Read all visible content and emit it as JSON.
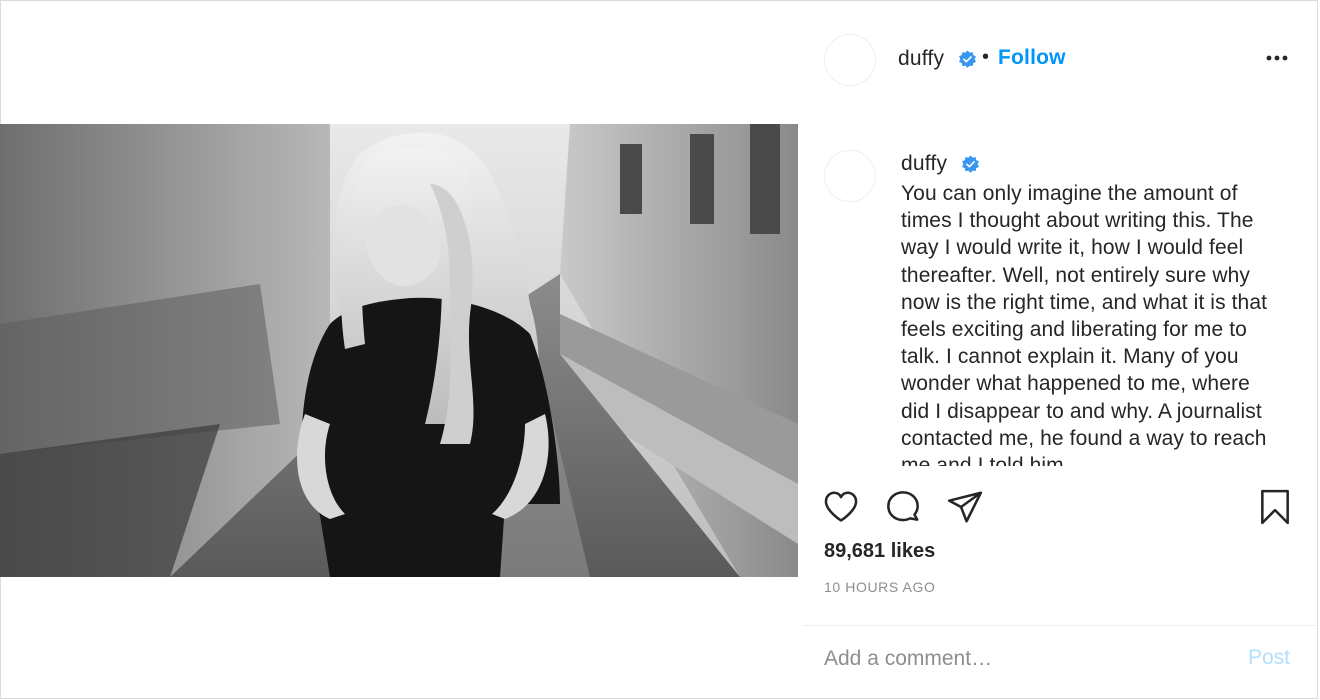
{
  "post": {
    "author": "duffy",
    "follow_label": "Follow",
    "separator": "•",
    "caption": "You can only imagine the amount of times I thought about writing this. The way I would write it, how I would feel thereafter. Well, not entirely sure why now is the right time, and what it is that feels exciting and liberating for me to talk. I cannot explain it. Many of you wonder what happened to me, where did I disappear to and why. A journalist contacted me, he found a way to reach me and I told him",
    "likes": "89,681 likes",
    "timestamp": "10 HOURS AGO",
    "comment_placeholder": "Add a comment…",
    "post_label": "Post"
  },
  "icons": {
    "verified": "verified-badge-icon",
    "more": "more-options-icon",
    "like": "heart-icon",
    "comment": "comment-bubble-icon",
    "share": "paper-plane-icon",
    "save": "bookmark-icon"
  },
  "colors": {
    "link_blue": "#0095f6",
    "verified_blue": "#3897f0",
    "post_disabled": "#b2dffc",
    "muted": "#8e8e8e",
    "text": "#262626"
  }
}
